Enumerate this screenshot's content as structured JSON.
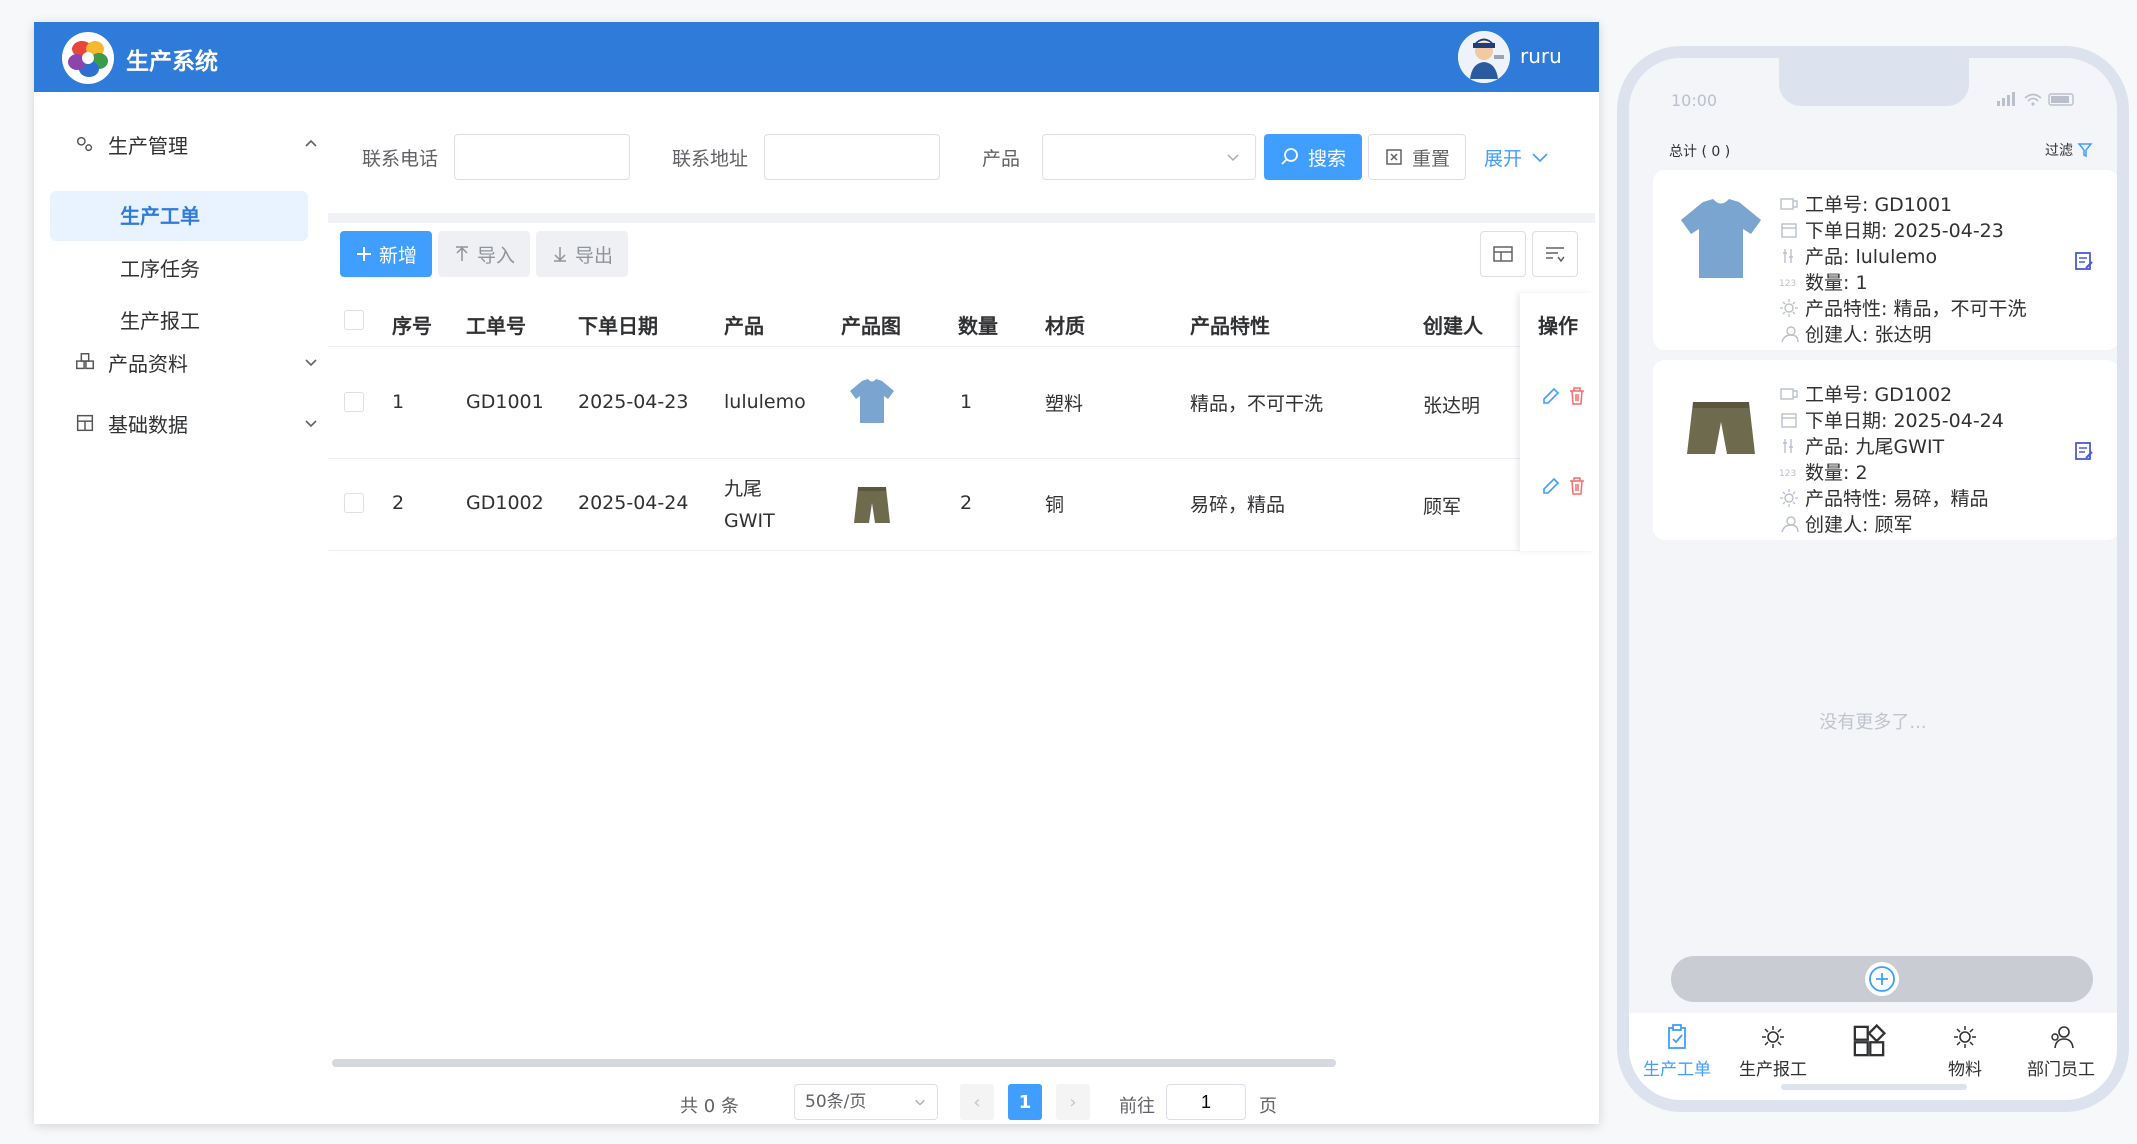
{
  "app": {
    "title": "生产系统",
    "user_name": "ruru",
    "brand_color": "#2f7bd9"
  },
  "sidebar": {
    "groups": [
      {
        "label": "生产管理",
        "expanded": true,
        "icon": "cogs-icon",
        "items": [
          {
            "label": "生产工单",
            "active": true
          },
          {
            "label": "工序任务"
          },
          {
            "label": "生产报工"
          }
        ]
      },
      {
        "label": "产品资料",
        "expanded": false,
        "icon": "cubes-icon"
      },
      {
        "label": "基础数据",
        "expanded": false,
        "icon": "database-icon"
      }
    ]
  },
  "search": {
    "phone_label": "联系电话",
    "phone_value": "",
    "address_label": "联系地址",
    "address_value": "",
    "product_label": "产品",
    "product_value": "",
    "search_btn": "搜索",
    "reset_btn": "重置",
    "expand_btn": "展开"
  },
  "toolbar": {
    "add": "新增",
    "import": "导入",
    "export": "导出"
  },
  "table": {
    "columns": [
      "序号",
      "工单号",
      "下单日期",
      "产品",
      "产品图",
      "数量",
      "材质",
      "产品特性",
      "创建人",
      "操作"
    ],
    "rows": [
      {
        "index": "1",
        "order_no": "GD1001",
        "date": "2025-04-23",
        "product": "lululemo",
        "image": "blue-tshirt",
        "qty": "1",
        "material": "塑料",
        "feature": "精品，不可干洗",
        "creator": "张达明"
      },
      {
        "index": "2",
        "order_no": "GD1002",
        "date": "2025-04-24",
        "product": "九尾GWIT",
        "image": "olive-shorts",
        "qty": "2",
        "material": "铜",
        "feature": "易碎，精品",
        "creator": "顾军"
      }
    ]
  },
  "pagination": {
    "total_text": "共 0 条",
    "page_size": "50条/页",
    "current": "1",
    "goto_label": "前往",
    "goto_value": "1",
    "page_suffix": "页"
  },
  "mobile": {
    "time": "10:00",
    "total": "总计 ( 0 )",
    "filter": "过滤",
    "cards": [
      {
        "order_no": "工单号: GD1001",
        "date": "下单日期: 2025-04-23",
        "product": "产品: lululemo",
        "qty": "数量: 1",
        "feature": "产品特性: 精品，不可干洗",
        "creator": "创建人: 张达明"
      },
      {
        "order_no": "工单号: GD1002",
        "date": "下单日期: 2025-04-24",
        "product": "产品: 九尾GWIT",
        "qty": "数量: 2",
        "feature": "产品特性: 易碎，精品",
        "creator": "创建人: 顾军"
      }
    ],
    "no_more": "没有更多了...",
    "tabs": [
      {
        "label": "生产工单",
        "active": true
      },
      {
        "label": "生产报工"
      },
      {
        "label": ""
      },
      {
        "label": "物料"
      },
      {
        "label": "部门员工"
      }
    ]
  }
}
